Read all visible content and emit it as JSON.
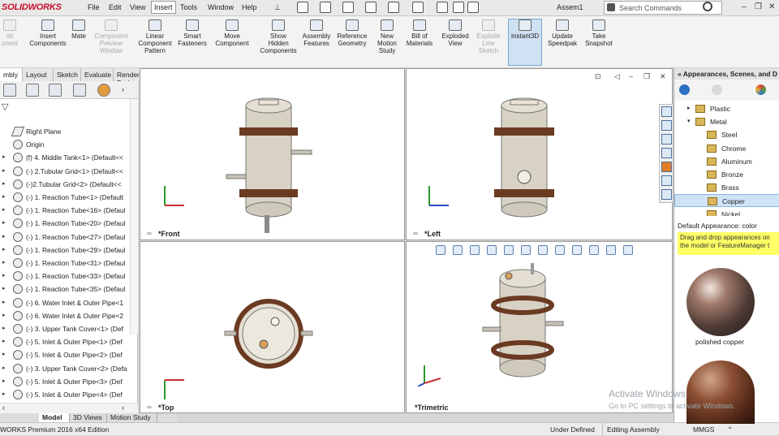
{
  "app": {
    "logo": "SOLIDWORKS",
    "doc_title": "Assem1"
  },
  "menu": [
    "File",
    "Edit",
    "View",
    "Insert",
    "Tools",
    "Window",
    "Help"
  ],
  "menu_active": "Insert",
  "search": {
    "placeholder": "Search Commands"
  },
  "ribbon": [
    {
      "label": "dit\nonent",
      "disabled": true
    },
    {
      "label": "Insert\nComponents",
      "disabled": false
    },
    {
      "label": "Mate",
      "disabled": false
    },
    {
      "label": "Component\nPreview\nWindow",
      "disabled": true
    },
    {
      "label": "Linear\nComponent\nPattern",
      "disabled": false
    },
    {
      "label": "Smart\nFasteners",
      "disabled": false
    },
    {
      "label": "Move\nComponent",
      "disabled": false
    },
    {
      "label": "Show\nHidden\nComponents",
      "disabled": false
    },
    {
      "label": "Assembly\nFeatures",
      "disabled": false
    },
    {
      "label": "Reference\nGeometry",
      "disabled": false
    },
    {
      "label": "New\nMotion\nStudy",
      "disabled": false
    },
    {
      "label": "Bill of\nMaterials",
      "disabled": false
    },
    {
      "label": "Exploded\nView",
      "disabled": false
    },
    {
      "label": "Explode\nLine\nSketch",
      "disabled": true
    },
    {
      "label": "Instant3D",
      "disabled": false,
      "selected": true
    },
    {
      "label": "Update\nSpeedpak",
      "disabled": false
    },
    {
      "label": "Take\nSnapshot",
      "disabled": false
    }
  ],
  "command_tabs": [
    "mbly",
    "Layout",
    "Sketch",
    "Evaluate",
    "Render Tools",
    "SOLIDWORKS Add-Ins",
    "SOLIDWORKS MBD"
  ],
  "feature_tree": [
    {
      "label": "Right Plane",
      "type": "plane",
      "expand": false
    },
    {
      "label": "Origin",
      "type": "origin",
      "expand": false
    },
    {
      "label": "(f) 4. Middle Tank<1> (Default<<",
      "expand": true
    },
    {
      "label": "(-) 2.Tubular Grid<1> (Default<<",
      "expand": true
    },
    {
      "label": "(-)2.Tubular Grid<2> (Default<<",
      "expand": true
    },
    {
      "label": "(-) 1. Reaction Tube<1> (Default",
      "expand": true
    },
    {
      "label": "(-) 1. Reaction Tube<16> (Defaul",
      "expand": true
    },
    {
      "label": "(-) 1. Reaction Tube<20> (Defaul",
      "expand": true
    },
    {
      "label": "(-) 1. Reaction Tube<27> (Defaul",
      "expand": true
    },
    {
      "label": "(-) 1. Reaction Tube<29> (Defaul",
      "expand": true
    },
    {
      "label": "(-) 1. Reaction Tube<31> (Defaul",
      "expand": true
    },
    {
      "label": "(-) 1. Reaction Tube<33> (Defaul",
      "expand": true
    },
    {
      "label": "(-) 1. Reaction Tube<35> (Defaul",
      "expand": true
    },
    {
      "label": "(-) 6. Water Inlet & Outer Pipe<1",
      "expand": true
    },
    {
      "label": "(-) 6. Water Inlet & Outer Pipe<2",
      "expand": true
    },
    {
      "label": "(-) 3. Upper Tank Cover<1> (Def",
      "expand": true
    },
    {
      "label": "(-) 5. Inlet & Outer Pipe<1> (Def",
      "expand": true
    },
    {
      "label": "(-) 5. Inlet & Outer Pipe<2> (Def",
      "expand": true
    },
    {
      "label": "(-) 3. Upper Tank Cover<2> (Defa",
      "expand": true
    },
    {
      "label": "(-) 5. Inlet & Outer Pipe<3> (Def",
      "expand": true
    },
    {
      "label": "(-) 5. Inlet & Outer Pipe<4> (Def",
      "expand": true
    }
  ],
  "viewports": [
    {
      "label": "*Front",
      "view": "front"
    },
    {
      "label": "*Left",
      "view": "left"
    },
    {
      "label": "*Top",
      "view": "top"
    },
    {
      "label": "*Trimetric",
      "view": "trimetric"
    }
  ],
  "bottom_tabs": [
    "Model",
    "3D Views",
    "Motion Study 1"
  ],
  "status": {
    "edition": "WORKS Premium 2016 x64 Edition",
    "defined": "Under Defined",
    "mode": "Editing Assembly",
    "units": "MMGS"
  },
  "task_pane": {
    "title": "Appearances, Scenes, and D",
    "tree": [
      {
        "label": "Plastic",
        "level": 1,
        "expand": "right"
      },
      {
        "label": "Metal",
        "level": 1,
        "expand": "down"
      },
      {
        "label": "Steel",
        "level": 2
      },
      {
        "label": "Chrome",
        "level": 2
      },
      {
        "label": "Aluminum",
        "level": 2
      },
      {
        "label": "Bronze",
        "level": 2
      },
      {
        "label": "Brass",
        "level": 2
      },
      {
        "label": "Copper",
        "level": 2,
        "selected": true
      },
      {
        "label": "Nickel",
        "level": 2
      }
    ],
    "default_label": "Default Appearance: color",
    "hint": "Drag and drop appearances on\nthe model or FeatureManager t",
    "swatches": [
      {
        "label": "polished copper"
      },
      {
        "label": ""
      }
    ]
  },
  "watermark": {
    "line1": "Activate Windows",
    "line2": "Go to PC settings to activate Windows."
  },
  "colors": {
    "accent": "#c8102e",
    "tank": "#d7d2c3",
    "flange": "#6b3a22",
    "copper": "#6a3a24"
  }
}
